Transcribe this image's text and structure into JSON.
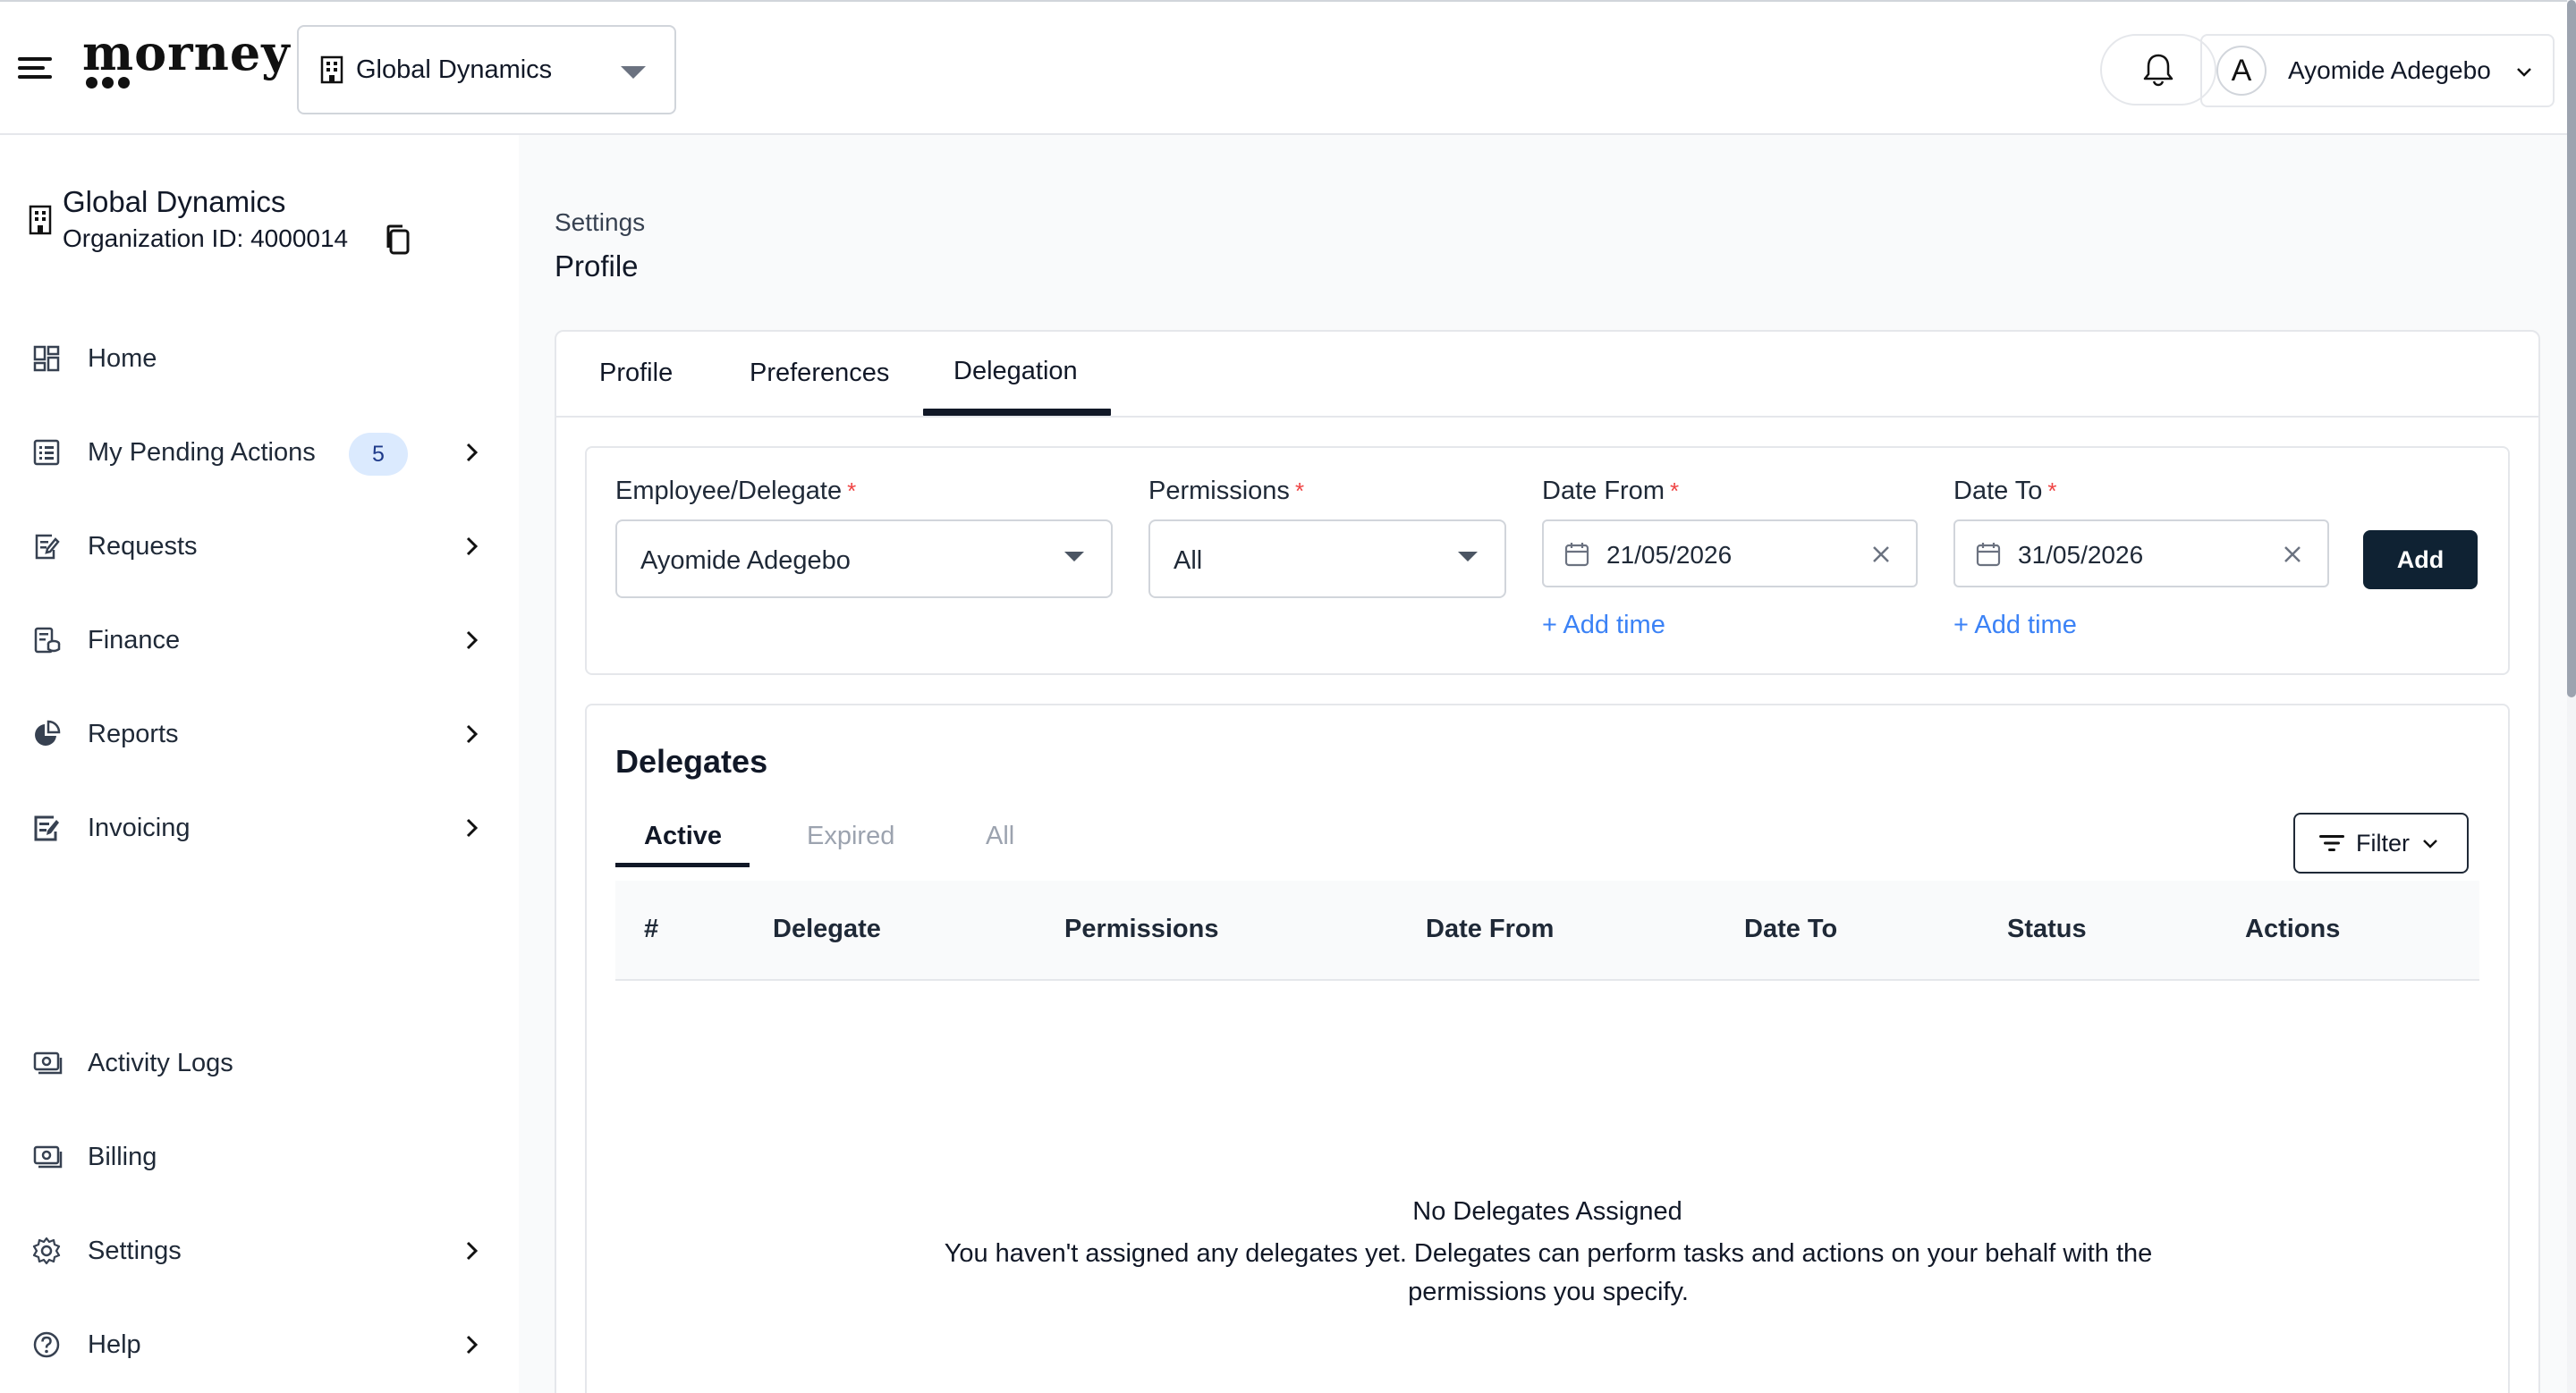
{
  "header": {
    "logo_text": "morney",
    "org_selector": {
      "label": "Global Dynamics",
      "icon": "building-icon"
    },
    "user": {
      "initial": "A",
      "name": "Ayomide Adegebo"
    }
  },
  "sidebar": {
    "org": {
      "name": "Global Dynamics",
      "id_text": "Organization ID: 4000014"
    },
    "items": [
      {
        "label": "Home",
        "icon": "dashboard-icon"
      },
      {
        "label": "My Pending Actions",
        "icon": "list-icon",
        "badge": "5"
      },
      {
        "label": "Requests",
        "icon": "edit-document-icon"
      },
      {
        "label": "Finance",
        "icon": "finance-icon"
      },
      {
        "label": "Reports",
        "icon": "pie-chart-icon"
      },
      {
        "label": "Invoicing",
        "icon": "invoice-icon"
      },
      {
        "label": "Activity Logs",
        "icon": "cash-icon"
      },
      {
        "label": "Billing",
        "icon": "billing-icon"
      },
      {
        "label": "Settings",
        "icon": "gear-icon"
      },
      {
        "label": "Help",
        "icon": "help-icon"
      }
    ]
  },
  "main": {
    "breadcrumb": "Settings",
    "title": "Profile",
    "tabs": [
      {
        "label": "Profile"
      },
      {
        "label": "Preferences"
      },
      {
        "label": "Delegation"
      }
    ],
    "active_tab": "Delegation",
    "form": {
      "employee": {
        "label": "Employee/Delegate",
        "value": "Ayomide Adegebo"
      },
      "permissions": {
        "label": "Permissions",
        "value": "All"
      },
      "date_from": {
        "label": "Date From",
        "value": "21/05/2026"
      },
      "date_to": {
        "label": "Date To",
        "value": "31/05/2026"
      },
      "required_mark": "*",
      "add_time": "+ Add time",
      "add_button": "Add"
    },
    "delegates": {
      "title": "Delegates",
      "subtabs": [
        "Active",
        "Expired",
        "All"
      ],
      "active_subtab": "Active",
      "filter_label": "Filter",
      "columns": [
        "#",
        "Delegate",
        "Permissions",
        "Date From",
        "Date To",
        "Status",
        "Actions"
      ],
      "rows": [],
      "empty_title": "No Delegates Assigned",
      "empty_desc": "You haven't assigned any delegates yet. Delegates can perform tasks and actions on your behalf with the permissions you specify."
    }
  },
  "colors": {
    "accent_dark": "#0f2233",
    "link": "#3b82f6",
    "required": "#ef4444",
    "badge_bg": "#dbeafe"
  }
}
